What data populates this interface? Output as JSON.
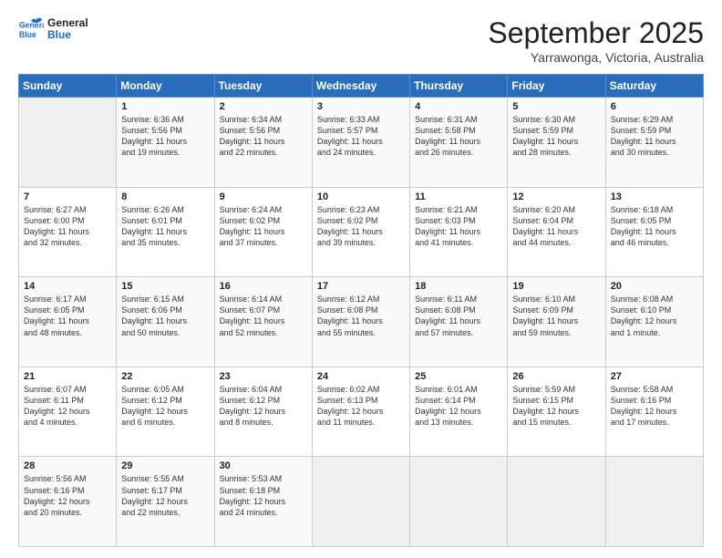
{
  "header": {
    "logo_line1": "General",
    "logo_line2": "Blue",
    "month": "September 2025",
    "location": "Yarrawonga, Victoria, Australia"
  },
  "weekdays": [
    "Sunday",
    "Monday",
    "Tuesday",
    "Wednesday",
    "Thursday",
    "Friday",
    "Saturday"
  ],
  "weeks": [
    [
      {
        "day": "",
        "info": ""
      },
      {
        "day": "1",
        "info": "Sunrise: 6:36 AM\nSunset: 5:56 PM\nDaylight: 11 hours\nand 19 minutes."
      },
      {
        "day": "2",
        "info": "Sunrise: 6:34 AM\nSunset: 5:56 PM\nDaylight: 11 hours\nand 22 minutes."
      },
      {
        "day": "3",
        "info": "Sunrise: 6:33 AM\nSunset: 5:57 PM\nDaylight: 11 hours\nand 24 minutes."
      },
      {
        "day": "4",
        "info": "Sunrise: 6:31 AM\nSunset: 5:58 PM\nDaylight: 11 hours\nand 26 minutes."
      },
      {
        "day": "5",
        "info": "Sunrise: 6:30 AM\nSunset: 5:59 PM\nDaylight: 11 hours\nand 28 minutes."
      },
      {
        "day": "6",
        "info": "Sunrise: 6:29 AM\nSunset: 5:59 PM\nDaylight: 11 hours\nand 30 minutes."
      }
    ],
    [
      {
        "day": "7",
        "info": "Sunrise: 6:27 AM\nSunset: 6:00 PM\nDaylight: 11 hours\nand 32 minutes."
      },
      {
        "day": "8",
        "info": "Sunrise: 6:26 AM\nSunset: 6:01 PM\nDaylight: 11 hours\nand 35 minutes."
      },
      {
        "day": "9",
        "info": "Sunrise: 6:24 AM\nSunset: 6:02 PM\nDaylight: 11 hours\nand 37 minutes."
      },
      {
        "day": "10",
        "info": "Sunrise: 6:23 AM\nSunset: 6:02 PM\nDaylight: 11 hours\nand 39 minutes."
      },
      {
        "day": "11",
        "info": "Sunrise: 6:21 AM\nSunset: 6:03 PM\nDaylight: 11 hours\nand 41 minutes."
      },
      {
        "day": "12",
        "info": "Sunrise: 6:20 AM\nSunset: 6:04 PM\nDaylight: 11 hours\nand 44 minutes."
      },
      {
        "day": "13",
        "info": "Sunrise: 6:18 AM\nSunset: 6:05 PM\nDaylight: 11 hours\nand 46 minutes."
      }
    ],
    [
      {
        "day": "14",
        "info": "Sunrise: 6:17 AM\nSunset: 6:05 PM\nDaylight: 11 hours\nand 48 minutes."
      },
      {
        "day": "15",
        "info": "Sunrise: 6:15 AM\nSunset: 6:06 PM\nDaylight: 11 hours\nand 50 minutes."
      },
      {
        "day": "16",
        "info": "Sunrise: 6:14 AM\nSunset: 6:07 PM\nDaylight: 11 hours\nand 52 minutes."
      },
      {
        "day": "17",
        "info": "Sunrise: 6:12 AM\nSunset: 6:08 PM\nDaylight: 11 hours\nand 55 minutes."
      },
      {
        "day": "18",
        "info": "Sunrise: 6:11 AM\nSunset: 6:08 PM\nDaylight: 11 hours\nand 57 minutes."
      },
      {
        "day": "19",
        "info": "Sunrise: 6:10 AM\nSunset: 6:09 PM\nDaylight: 11 hours\nand 59 minutes."
      },
      {
        "day": "20",
        "info": "Sunrise: 6:08 AM\nSunset: 6:10 PM\nDaylight: 12 hours\nand 1 minute."
      }
    ],
    [
      {
        "day": "21",
        "info": "Sunrise: 6:07 AM\nSunset: 6:11 PM\nDaylight: 12 hours\nand 4 minutes."
      },
      {
        "day": "22",
        "info": "Sunrise: 6:05 AM\nSunset: 6:12 PM\nDaylight: 12 hours\nand 6 minutes."
      },
      {
        "day": "23",
        "info": "Sunrise: 6:04 AM\nSunset: 6:12 PM\nDaylight: 12 hours\nand 8 minutes."
      },
      {
        "day": "24",
        "info": "Sunrise: 6:02 AM\nSunset: 6:13 PM\nDaylight: 12 hours\nand 11 minutes."
      },
      {
        "day": "25",
        "info": "Sunrise: 6:01 AM\nSunset: 6:14 PM\nDaylight: 12 hours\nand 13 minutes."
      },
      {
        "day": "26",
        "info": "Sunrise: 5:59 AM\nSunset: 6:15 PM\nDaylight: 12 hours\nand 15 minutes."
      },
      {
        "day": "27",
        "info": "Sunrise: 5:58 AM\nSunset: 6:16 PM\nDaylight: 12 hours\nand 17 minutes."
      }
    ],
    [
      {
        "day": "28",
        "info": "Sunrise: 5:56 AM\nSunset: 6:16 PM\nDaylight: 12 hours\nand 20 minutes."
      },
      {
        "day": "29",
        "info": "Sunrise: 5:55 AM\nSunset: 6:17 PM\nDaylight: 12 hours\nand 22 minutes."
      },
      {
        "day": "30",
        "info": "Sunrise: 5:53 AM\nSunset: 6:18 PM\nDaylight: 12 hours\nand 24 minutes."
      },
      {
        "day": "",
        "info": ""
      },
      {
        "day": "",
        "info": ""
      },
      {
        "day": "",
        "info": ""
      },
      {
        "day": "",
        "info": ""
      }
    ]
  ]
}
